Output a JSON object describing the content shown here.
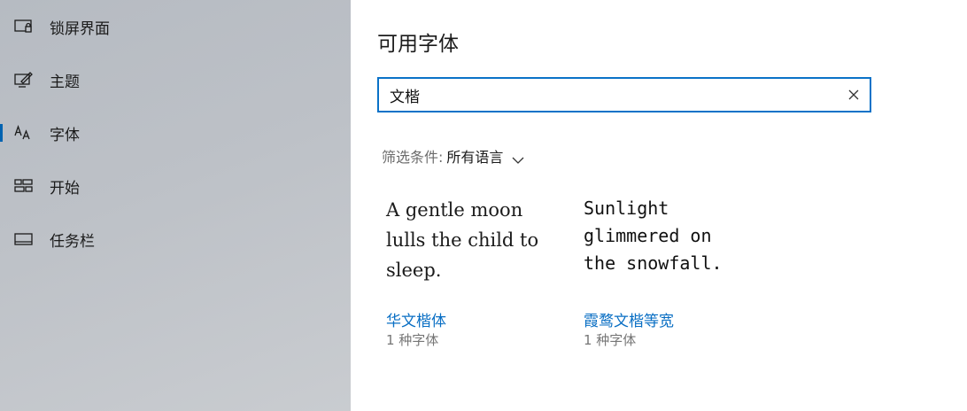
{
  "sidebar": {
    "items": [
      {
        "label": "锁屏界面",
        "icon": "lock-screen-icon"
      },
      {
        "label": "主题",
        "icon": "theme-brush-icon"
      },
      {
        "label": "字体",
        "icon": "font-aa-icon",
        "selected": true
      },
      {
        "label": "开始",
        "icon": "start-tiles-icon"
      },
      {
        "label": "任务栏",
        "icon": "taskbar-icon"
      }
    ]
  },
  "main": {
    "title": "可用字体",
    "search": {
      "value": "文楷",
      "clear_icon": "close-icon"
    },
    "filter": {
      "label": "筛选条件:",
      "value": "所有语言"
    },
    "fonts": [
      {
        "preview": "A gentle moon\nlulls the child to\nsleep.",
        "name": "华文楷体",
        "count": "1 种字体"
      },
      {
        "preview": "Sunlight\nglimmered on\nthe snowfall.",
        "name": "霞鹜文楷等宽",
        "count": "1 种字体"
      }
    ]
  },
  "colors": {
    "accent": "#0a72c8",
    "link": "#0a6fc4",
    "sidebar_bg": "#bcc0c6"
  }
}
